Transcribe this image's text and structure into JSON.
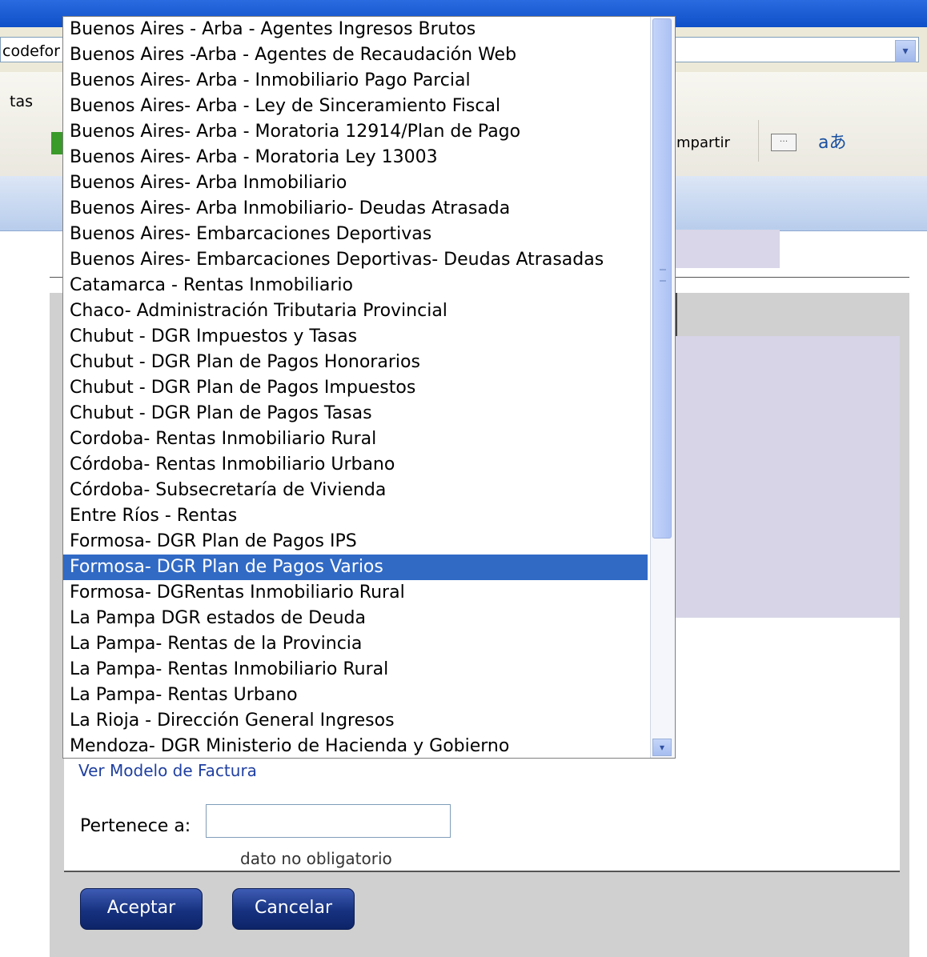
{
  "browser": {
    "address_fragment": "codefor",
    "menu_fragment": "tas",
    "share_fragment": "mpartir",
    "dropdown_arrow": "▾",
    "translate_icon": "aあ"
  },
  "dropdown": {
    "options": [
      "Buenos Aires - Arba - Agentes Ingresos Brutos",
      "Buenos Aires -Arba - Agentes de Recaudación Web",
      "Buenos Aires- Arba - Inmobiliario Pago Parcial",
      "Buenos Aires- Arba - Ley de Sinceramiento Fiscal",
      "Buenos Aires- Arba - Moratoria 12914/Plan de Pago",
      "Buenos Aires- Arba - Moratoria Ley 13003",
      "Buenos Aires- Arba Inmobiliario",
      "Buenos Aires- Arba Inmobiliario- Deudas Atrasada",
      "Buenos Aires- Embarcaciones Deportivas",
      "Buenos Aires- Embarcaciones Deportivas- Deudas Atrasadas",
      "Catamarca - Rentas Inmobiliario",
      "Chaco- Administración Tributaria Provincial",
      "Chubut - DGR Impuestos y Tasas",
      "Chubut - DGR Plan de Pagos Honorarios",
      "Chubut - DGR Plan de Pagos Impuestos",
      "Chubut - DGR Plan de Pagos Tasas",
      "Cordoba- Rentas Inmobiliario Rural",
      "Córdoba- Rentas Inmobiliario Urbano",
      "Córdoba- Subsecretaría de Vivienda",
      "Entre Ríos - Rentas",
      "Formosa- DGR Plan de Pagos IPS",
      "Formosa- DGR Plan de Pagos Varios",
      "Formosa- DGRentas Inmobiliario Rural",
      "La Pampa DGR estados de Deuda",
      "La Pampa- Rentas de la Provincia",
      "La Pampa- Rentas Inmobiliario Rural",
      "La Pampa- Rentas Urbano",
      "La Rioja - Dirección General Ingresos",
      "Mendoza- DGR Ministerio de Hacienda y Gobierno"
    ],
    "selected_index": 21,
    "selected_color": "#316ac5",
    "scroll_down_glyph": "▾"
  },
  "form": {
    "ver_modelo_link": "Ver Modelo de Factura",
    "pertenece_label": "Pertenece a:",
    "pertenece_value": "",
    "pertenece_hint": "dato no obligatorio",
    "accept_label": "Aceptar",
    "cancel_label": "Cancelar",
    "button_color": "#16317f"
  }
}
